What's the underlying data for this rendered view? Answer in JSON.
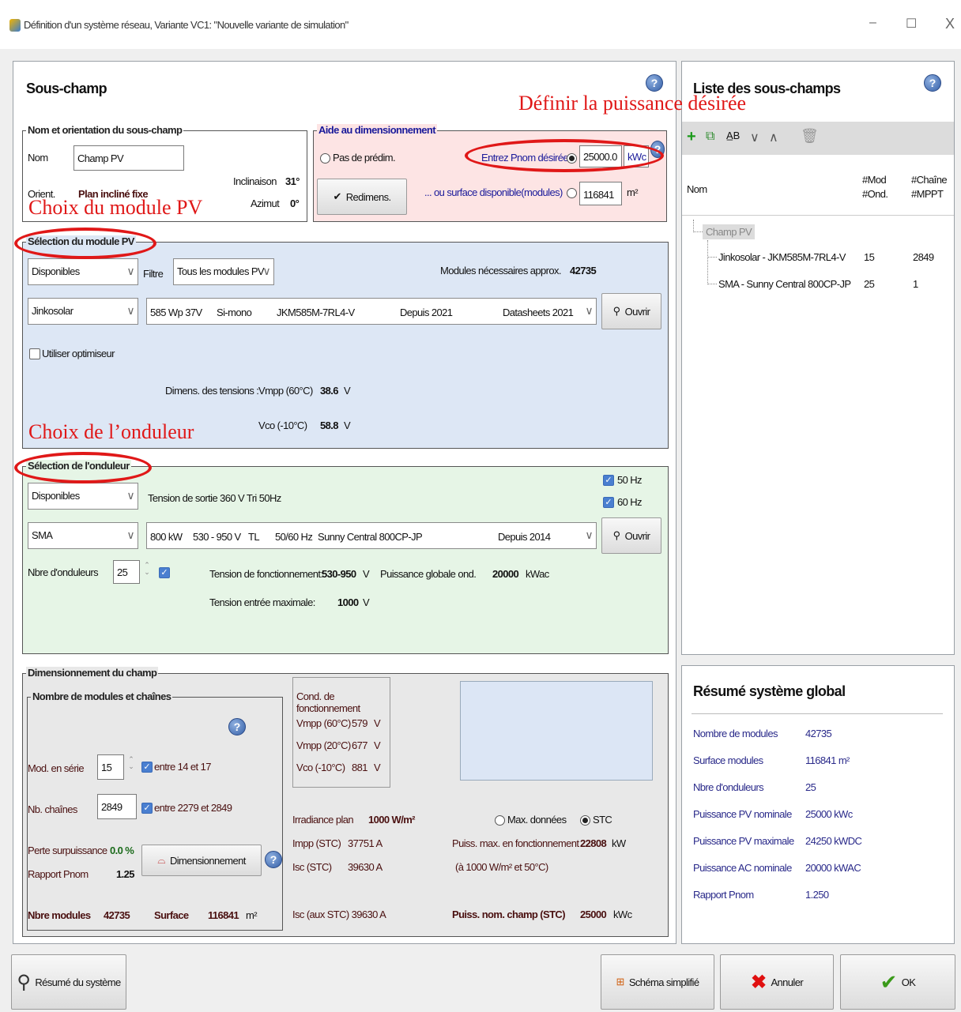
{
  "window": {
    "title": "Définition d'un système réseau, Variante VC1:  \"Nouvelle variante de simulation\"",
    "min_glyph": "–",
    "max_glyph": "☐",
    "close_glyph": "X"
  },
  "annotations": {
    "puissance": "Définir la puissance désirée",
    "module": "Choix du module PV",
    "onduleur": "Choix de l’onduleur",
    "color": "#e01818"
  },
  "subfield": {
    "title": "Sous-champ",
    "help": "?",
    "orientation": {
      "legend": "Nom et orientation du sous-champ",
      "name_label": "Nom",
      "name_value": "Champ PV",
      "orient_label": "Orient.",
      "orient_value": "Plan incliné fixe",
      "inclinaison_label": "Inclinaison",
      "inclinaison_value": "31°",
      "azimut_label": "Azimut",
      "azimut_value": "0°"
    },
    "sizing_help": {
      "legend": "Aide au dimensionnement",
      "no_presizing": "Pas de prédim.",
      "pnom_label": "Entrez Pnom désirée",
      "pnom_value": "25000.0",
      "pnom_unit": "kWc",
      "surface_label": "... ou surface disponible(modules)",
      "surface_value": "116841",
      "surface_unit": "m²",
      "redimens_button": "Redimens."
    },
    "module": {
      "legend": "Sélection du module PV",
      "availability": "Disponibles",
      "filter_label": "Filtre",
      "filter_value": "Tous les modules PV",
      "needed_label": "Modules nécessaires approx.",
      "needed_value": "42735",
      "manufacturer": "Jinkosolar",
      "model_power": "585 Wp 37V",
      "model_tech": "Si-mono",
      "model_name": "JKM585M-7RL4-V",
      "model_since": "Depuis 2021",
      "model_source": "Datasheets 2021",
      "open_button": "Ouvrir",
      "optimizer_label": "Utiliser optimiseur",
      "voltage_label": "Dimens. des tensions :",
      "vmpp_label": "Vmpp (60°C)",
      "vmpp_value": "38.6",
      "vmpp_unit": "V",
      "vco_label": "Vco (-10°C)",
      "vco_value": "58.8",
      "vco_unit": "V"
    },
    "inverter": {
      "legend": "Sélection de l'onduleur",
      "availability": "Disponibles",
      "output_voltage": "Tension de sortie 360 V Tri 50Hz",
      "hz50": "50 Hz",
      "hz60": "60 Hz",
      "manufacturer": "SMA",
      "model_power": "800 kW",
      "model_range": "530 - 950 V",
      "model_tl": "TL",
      "model_freq": "50/60 Hz",
      "model_name": "Sunny Central 800CP-JP",
      "model_since": "Depuis 2014",
      "open_button": "Ouvrir",
      "count_label": "Nbre d'onduleurs",
      "count_value": "25",
      "op_voltage_label": "Tension de fonctionnement:",
      "op_voltage_value": "530-950",
      "op_voltage_unit": "V",
      "global_power_label": "Puissance globale ond.",
      "global_power_value": "20000",
      "global_power_unit": "kWac",
      "max_input_label": "Tension entrée maximale:",
      "max_input_value": "1000",
      "max_input_unit": "V"
    },
    "array": {
      "legend": "Dimensionnement du champ",
      "inner_legend": "Nombre de modules et chaînes",
      "series_label": "Mod. en série",
      "series_value": "15",
      "series_range": "entre 14 et 17",
      "strings_label": "Nb. chaînes",
      "strings_value": "2849",
      "strings_range": "entre 2279 et 2849",
      "overload_label": "Perte surpuissance",
      "overload_value": "0.0 %",
      "ratio_label": "Rapport Pnom",
      "ratio_value": "1.25",
      "sizing_button": "Dimensionnement",
      "nb_modules_label": "Nbre modules",
      "nb_modules_value": "42735",
      "surface_label": "Surface",
      "surface_value": "116841",
      "surface_unit": "m²",
      "cond_title": "Cond. de fonctionnement",
      "cond_rows": [
        {
          "label": "Vmpp (60°C)",
          "value": "579",
          "unit": "V"
        },
        {
          "label": "Vmpp (20°C)",
          "value": "677",
          "unit": "V"
        },
        {
          "label": "Vco (-10°C)",
          "value": "881",
          "unit": "V"
        }
      ],
      "irradiance_label": "Irradiance plan",
      "irradiance_value": "1000 W/m²",
      "impp_label": "Impp (STC)",
      "impp_value": "37751 A",
      "isc_label": "Isc (STC)",
      "isc_value": "39630 A",
      "isc_aux": "Isc (aux STC) 39630 A",
      "max_data_label": "Max. données",
      "stc_label": "STC",
      "pmax_label": "Puiss. max. en fonctionnement",
      "pmax_value": "22808",
      "pmax_unit": "kW",
      "pmax_note": "(à 1000 W/m²  et 50°C)",
      "pnom_label": "Puiss. nom. champ (STC)",
      "pnom_value": "25000",
      "pnom_unit": "kWc"
    }
  },
  "subfields_list": {
    "title": "Liste des sous-champs",
    "help": "?",
    "col_name": "Nom",
    "col_mod": "#Mod",
    "col_ond": "#Ond.",
    "col_chain": "#Chaîne",
    "col_mppt": "#MPPT",
    "root": "Champ PV",
    "rows": [
      {
        "name": "Jinkosolar - JKM585M-7RL4-V",
        "a": "15",
        "b": "2849"
      },
      {
        "name": "SMA - Sunny Central 800CP-JP",
        "a": "25",
        "b": "1"
      }
    ]
  },
  "summary": {
    "title": "Résumé système global",
    "rows": [
      {
        "label": "Nombre de modules",
        "value": "42735"
      },
      {
        "label": "Surface modules",
        "value": "116841 m²"
      },
      {
        "label": "Nbre d'onduleurs",
        "value": "25"
      },
      {
        "label": "Puissance PV nominale",
        "value": "25000 kWc"
      },
      {
        "label": "Puissance PV maximale",
        "value": "24250 kWDC"
      },
      {
        "label": "Puissance AC nominale",
        "value": "20000 kWAC"
      },
      {
        "label": "Rapport Pnom",
        "value": "1.250"
      }
    ]
  },
  "footer": {
    "summary_button": "Résumé du système",
    "schema_button": "Schéma simplifié",
    "cancel_button": "Annuler",
    "ok_button": "OK"
  }
}
